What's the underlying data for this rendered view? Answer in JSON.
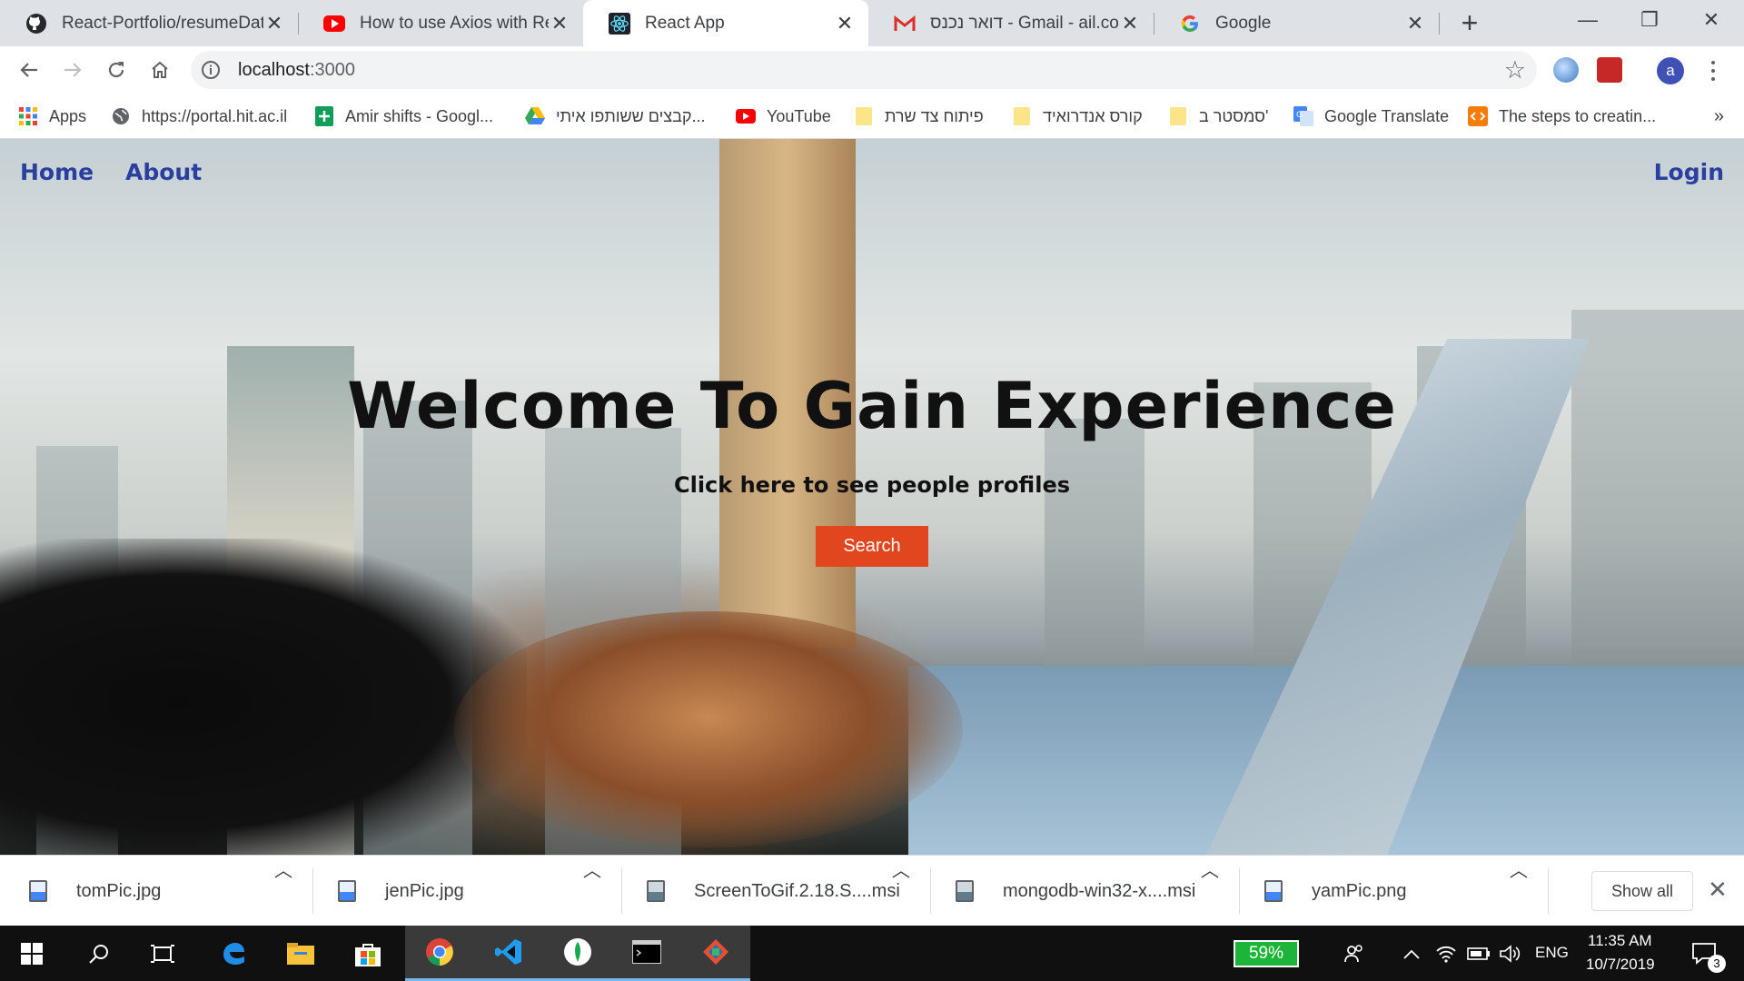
{
  "browser": {
    "tabs": [
      {
        "title": "React-Portfolio/resumeData",
        "icon": "github-icon"
      },
      {
        "title": "How to use Axios with React",
        "icon": "youtube-icon"
      },
      {
        "title": "React App",
        "icon": "react-icon"
      },
      {
        "title": "דואר נכנס - Gmail - ail.com",
        "icon": "gmail-icon"
      },
      {
        "title": "Google",
        "icon": "google-icon"
      }
    ],
    "active_tab": "React App",
    "url_host": "localhost",
    "url_port": ":3000",
    "profile_initial": "a"
  },
  "bookmarks": [
    {
      "label": "Apps",
      "icon": "apps-grid-icon"
    },
    {
      "label": "https://portal.hit.ac.il",
      "icon": "globe-icon"
    },
    {
      "label": "Amir shifts - Googl...",
      "icon": "sheets-icon"
    },
    {
      "label": "קבצים ששותפו איתי...",
      "icon": "drive-icon"
    },
    {
      "label": "YouTube",
      "icon": "youtube-icon"
    },
    {
      "label": "פיתוח צד שרת",
      "icon": "folder-icon"
    },
    {
      "label": "קורס אנדרואיד",
      "icon": "folder-icon"
    },
    {
      "label": "סמסטר ב'",
      "icon": "folder-icon"
    },
    {
      "label": "Google Translate",
      "icon": "translate-icon"
    },
    {
      "label": "The steps to creatin...",
      "icon": "code-icon"
    }
  ],
  "page": {
    "nav": {
      "home": "Home",
      "about": "About",
      "login": "Login"
    },
    "hero_title": "Welcome To Gain Experience",
    "hero_subtitle": "Click here to see people profiles",
    "search_button": "Search",
    "colors": {
      "button": "#e2461f",
      "nav_link": "#2b3fa0"
    }
  },
  "downloads": {
    "items": [
      "tomPic.jpg",
      "jenPic.jpg",
      "ScreenToGif.2.18.S....msi",
      "mongodb-win32-x....msi",
      "yamPic.png"
    ],
    "show_all": "Show all"
  },
  "taskbar": {
    "battery": "59%",
    "language": "ENG",
    "time": "11:35 AM",
    "date": "10/7/2019",
    "notifications": "3"
  }
}
